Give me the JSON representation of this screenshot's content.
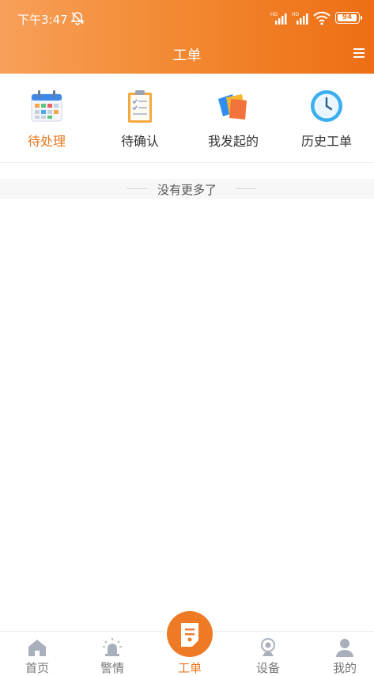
{
  "status_bar": {
    "time": "下午3:47",
    "battery": "94"
  },
  "header": {
    "title": "工单"
  },
  "tabs": [
    {
      "label": "待处理",
      "icon": "calendar-icon",
      "active": true
    },
    {
      "label": "待确认",
      "icon": "clipboard-icon",
      "active": false
    },
    {
      "label": "我发起的",
      "icon": "notes-icon",
      "active": false
    },
    {
      "label": "历史工单",
      "icon": "clock-icon",
      "active": false
    }
  ],
  "list": {
    "empty_text": "没有更多了"
  },
  "bottom_nav": [
    {
      "label": "首页",
      "icon": "home-icon",
      "active": false
    },
    {
      "label": "警情",
      "icon": "alarm-icon",
      "active": false
    },
    {
      "label": "工单",
      "icon": "work-order-icon",
      "active": true
    },
    {
      "label": "设备",
      "icon": "camera-icon",
      "active": false
    },
    {
      "label": "我的",
      "icon": "user-icon",
      "active": false
    }
  ],
  "colors": {
    "accent": "#ee7a25",
    "header_start": "#f7a05a",
    "header_end": "#ee6e14"
  }
}
